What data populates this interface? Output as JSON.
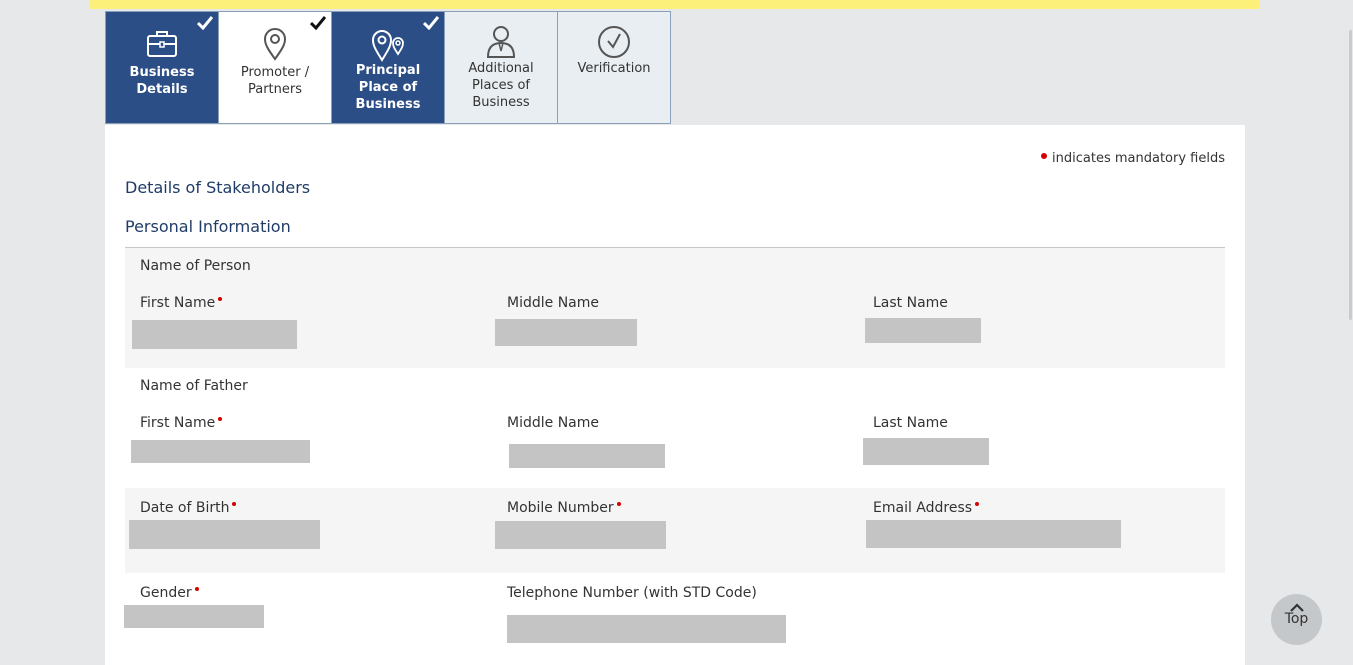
{
  "tabs": [
    {
      "label_line1": "Business",
      "label_line2": "Details",
      "label_line3": "",
      "icon": "briefcase-icon",
      "status": "done"
    },
    {
      "label_line1": "Promoter /",
      "label_line2": "Partners",
      "label_line3": "",
      "icon": "map-pin-icon",
      "status": "done"
    },
    {
      "label_line1": "Principal",
      "label_line2": "Place of",
      "label_line3": "Business",
      "icon": "double-map-pin-icon",
      "status": "done"
    },
    {
      "label_line1": "Additional",
      "label_line2": "Places of",
      "label_line3": "Business",
      "icon": "person-icon",
      "status": "pending"
    },
    {
      "label_line1": "Verification",
      "label_line2": "",
      "label_line3": "",
      "icon": "check-circle-icon",
      "status": "pending"
    }
  ],
  "mandatory_note": "indicates mandatory fields",
  "section_title": "Details of Stakeholders",
  "subsection_title": "Personal Information",
  "person": {
    "group_label": "Name of Person",
    "first_name_label": "First Name",
    "middle_name_label": "Middle Name",
    "last_name_label": "Last Name"
  },
  "father": {
    "group_label": "Name of Father",
    "first_name_label": "First Name",
    "middle_name_label": "Middle Name",
    "last_name_label": "Last Name"
  },
  "contact": {
    "dob_label": "Date of Birth",
    "mobile_label": "Mobile Number",
    "email_label": "Email Address"
  },
  "other": {
    "gender_label": "Gender",
    "telephone_label": "Telephone Number (with STD Code)"
  },
  "top_button_label": "Top",
  "colors": {
    "accent": "#2c4e86",
    "required": "#d40000",
    "banner": "#fcf07a"
  }
}
